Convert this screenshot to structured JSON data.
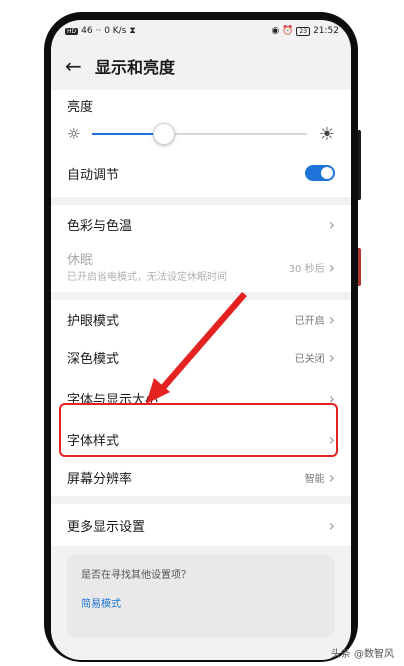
{
  "statusbar": {
    "left": "46 ··",
    "speed": "0 K/s",
    "battery": "23",
    "time": "21:52"
  },
  "header": {
    "title": "显示和亮度"
  },
  "brightness": {
    "label": "亮度",
    "level": 0.33
  },
  "auto_adjust": {
    "label": "自动调节",
    "on": true
  },
  "settings": [
    {
      "label": "色彩与色温",
      "value": ""
    }
  ],
  "sleep": {
    "label": "休眠",
    "subtitle": "已开启省电模式，无法设定休眠时间",
    "value": "30 秒后"
  },
  "settings2": [
    {
      "label": "护眼模式",
      "value": "已开启"
    },
    {
      "label": "深色模式",
      "value": "已关闭"
    },
    {
      "label": "字体与显示大小",
      "value": ""
    },
    {
      "label": "字体样式",
      "value": ""
    },
    {
      "label": "屏幕分辨率",
      "value": "智能"
    }
  ],
  "more": {
    "label": "更多显示设置"
  },
  "suggest": {
    "question": "是否在寻找其他设置项？",
    "link": "简易模式"
  },
  "watermark": "头条 @数智风",
  "colors": {
    "accent": "#1e73d8",
    "annotation": "#e52222"
  }
}
